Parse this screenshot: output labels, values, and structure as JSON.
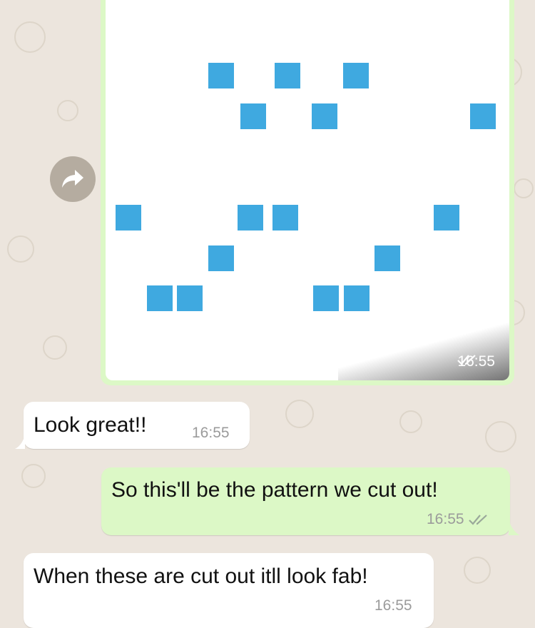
{
  "chat": {
    "image_message": {
      "time": "16:55",
      "status_icon": "double-check-icon",
      "pattern_color": "#3fa9e0",
      "overlay_button_icon": "forward-arrow-icon"
    },
    "messages": [
      {
        "direction": "incoming",
        "text": "Look great!!",
        "time": "16:55"
      },
      {
        "direction": "outgoing",
        "text": "So this'll be the pattern we cut out!",
        "time": "16:55",
        "status_icon": "double-check-icon"
      },
      {
        "direction": "incoming",
        "text": "When these are cut out itll look fab!",
        "time": "16:55"
      }
    ]
  },
  "colors": {
    "wallpaper": "#ece5dd",
    "outgoing_bubble": "#dcf8c6",
    "incoming_bubble": "#ffffff",
    "timestamp": "#9b9b9b",
    "forward_button": "#b5aca0"
  }
}
